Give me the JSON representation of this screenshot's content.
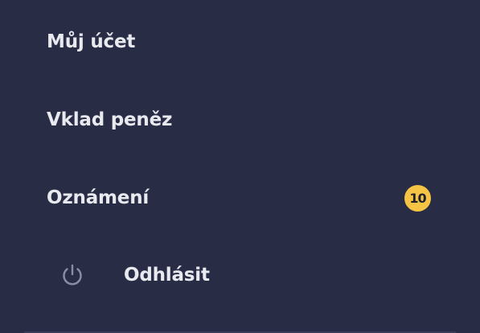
{
  "menu": {
    "items": [
      {
        "label": "Můj účet"
      },
      {
        "label": "Vklad peněz"
      },
      {
        "label": "Oznámení",
        "badge": "10"
      },
      {
        "label": "Odhlásit",
        "icon": "power-icon"
      }
    ]
  },
  "colors": {
    "background": "#292c45",
    "text": "#e9eaf0",
    "badge": "#f6c445",
    "icon": "#8b8ea3"
  }
}
